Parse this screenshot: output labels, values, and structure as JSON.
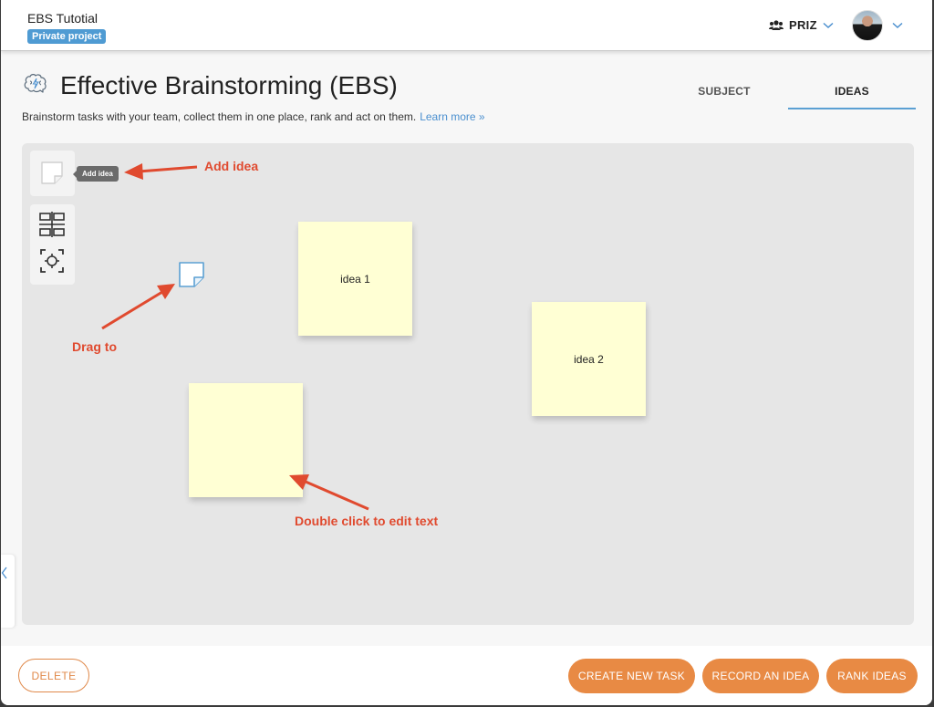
{
  "header": {
    "project_title": "EBS Tutotial",
    "project_badge": "Private project",
    "team_label": "PRIZ",
    "team_icon": "users-icon",
    "user_avatar": "user-avatar"
  },
  "page": {
    "icon": "brain-lightning-icon",
    "title": "Effective Brainstorming (EBS)",
    "description": "Brainstorm tasks with your team, collect them in one place, rank and act on them.",
    "learn_more": "Learn more »"
  },
  "tabs": [
    {
      "label": "SUBJECT",
      "active": false
    },
    {
      "label": "IDEAS",
      "active": true
    }
  ],
  "board": {
    "tools": {
      "add_idea_tooltip": "Add idea",
      "add_idea_icon": "sticky-note-icon",
      "arrange_icon": "grid-layout-icon",
      "center_icon": "focus-center-icon"
    },
    "notes": [
      {
        "text": "idea 1"
      },
      {
        "text": "idea 2"
      },
      {
        "text": ""
      }
    ],
    "annotations": {
      "add_idea": "Add idea",
      "drag_to": "Drag to",
      "double_click": "Double click to edit text"
    }
  },
  "footer": {
    "delete": "DELETE",
    "create_task": "CREATE NEW TASK",
    "record_idea": "RECORD AN IDEA",
    "rank_ideas": "RANK IDEAS"
  },
  "colors": {
    "accent_orange": "#e88a44",
    "annotation_red": "#e04a2f",
    "link_blue": "#4a8fcf",
    "badge_blue": "#4f9bd3",
    "sticky_yellow": "#ffffd4"
  }
}
